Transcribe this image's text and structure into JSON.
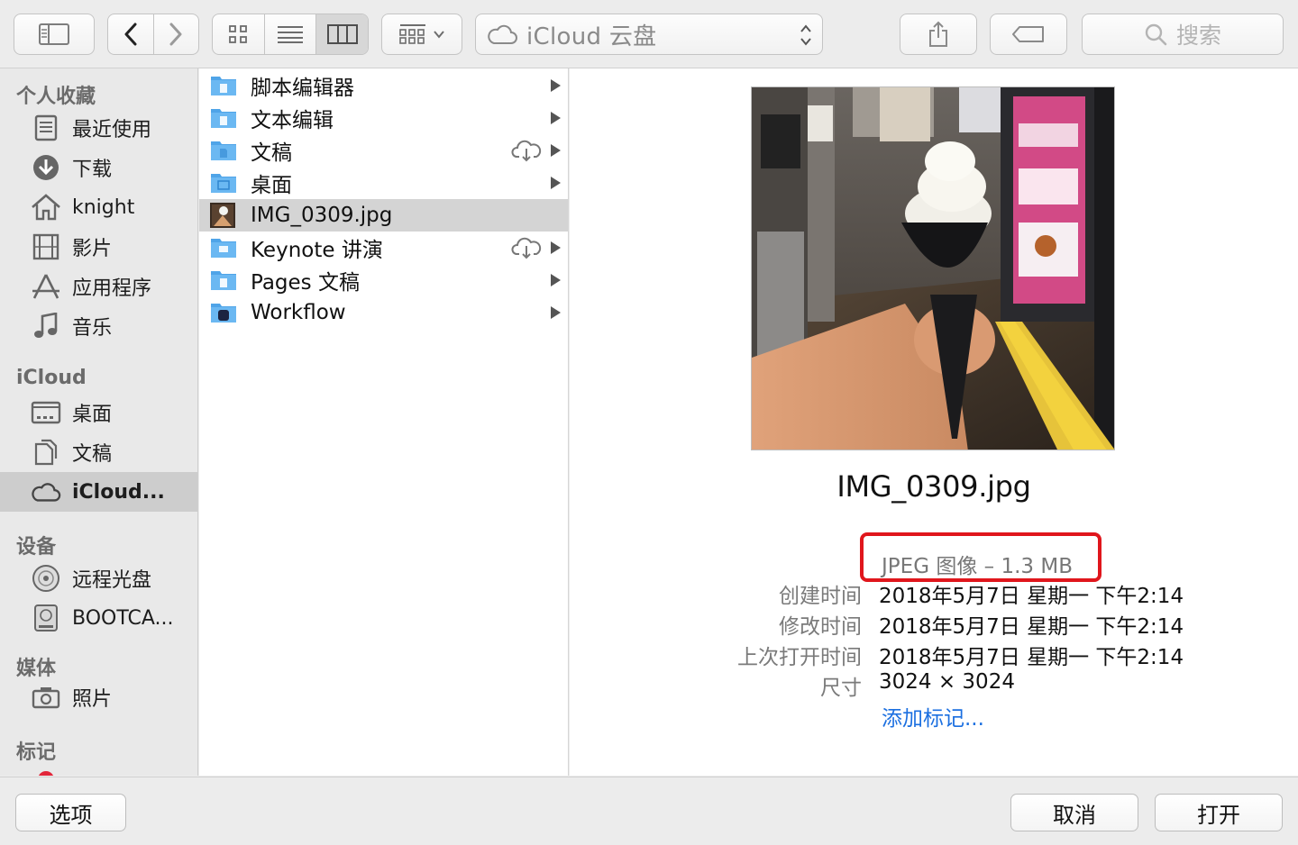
{
  "toolbar": {
    "location": "iCloud 云盘",
    "search_placeholder": "搜索"
  },
  "sidebar": {
    "sections": [
      {
        "title": "个人收藏",
        "items": [
          {
            "label": "最近使用",
            "icon": "recents-icon"
          },
          {
            "label": "下载",
            "icon": "downloads-icon"
          },
          {
            "label": "knight",
            "icon": "home-icon"
          },
          {
            "label": "影片",
            "icon": "movies-icon"
          },
          {
            "label": "应用程序",
            "icon": "applications-icon"
          },
          {
            "label": "音乐",
            "icon": "music-icon"
          }
        ]
      },
      {
        "title": "iCloud",
        "items": [
          {
            "label": "桌面",
            "icon": "desktop-icon"
          },
          {
            "label": "文稿",
            "icon": "documents-icon"
          },
          {
            "label": "iCloud...",
            "icon": "icloud-icon",
            "selected": true
          }
        ]
      },
      {
        "title": "设备",
        "items": [
          {
            "label": "远程光盘",
            "icon": "remote-disc-icon"
          },
          {
            "label": "BOOTCA...",
            "icon": "disk-icon"
          }
        ]
      },
      {
        "title": "媒体",
        "items": [
          {
            "label": "照片",
            "icon": "camera-icon"
          }
        ]
      },
      {
        "title": "标记",
        "items": []
      }
    ]
  },
  "files": [
    {
      "name": "脚本编辑器",
      "type": "folder",
      "cloud": false
    },
    {
      "name": "文本编辑",
      "type": "folder",
      "cloud": false
    },
    {
      "name": "文稿",
      "type": "folder",
      "cloud": true
    },
    {
      "name": "桌面",
      "type": "folder",
      "cloud": false
    },
    {
      "name": "IMG_0309.jpg",
      "type": "image",
      "cloud": false,
      "selected": true
    },
    {
      "name": "Keynote 讲演",
      "type": "folder",
      "cloud": true
    },
    {
      "name": "Pages 文稿",
      "type": "folder",
      "cloud": false
    },
    {
      "name": "Workflow",
      "type": "folder",
      "cloud": false
    }
  ],
  "preview": {
    "filename": "IMG_0309.jpg",
    "kind": "JPEG 图像 – 1.3 MB",
    "meta": [
      {
        "key": "创建时间",
        "value": "2018年5月7日 星期一 下午2:14"
      },
      {
        "key": "修改时间",
        "value": "2018年5月7日 星期一 下午2:14"
      },
      {
        "key": "上次打开时间",
        "value": "2018年5月7日 星期一 下午2:14"
      },
      {
        "key": "尺寸",
        "value": "3024 × 3024"
      }
    ],
    "add_tags": "添加标记..."
  },
  "buttons": {
    "options": "选项",
    "cancel": "取消",
    "open": "打开"
  },
  "colors": {
    "accent": "#1b6fe0",
    "highlight_box": "#e0161c",
    "folder_blue": "#5fb0ee"
  }
}
